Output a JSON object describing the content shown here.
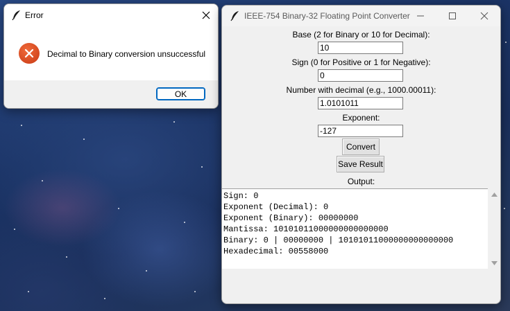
{
  "error_dialog": {
    "title": "Error",
    "message": "Decimal to Binary conversion unsuccessful",
    "ok_label": "OK",
    "icon": "error-icon",
    "icon_color": "#d9481c"
  },
  "main_window": {
    "title": "IEEE-754 Binary-32 Floating Point Converter",
    "fields": [
      {
        "label": "Base (2 for Binary or 10 for Decimal):",
        "value": "10"
      },
      {
        "label": "Sign (0 for Positive or 1 for Negative):",
        "value": "0"
      },
      {
        "label": "Number with decimal (e.g., 1000.00011):",
        "value": "1.0101011"
      },
      {
        "label": "Exponent:",
        "value": "-127"
      }
    ],
    "convert_label": "Convert",
    "save_label": "Save Result",
    "output_label": "Output:",
    "output_lines": [
      "Sign: 0",
      "Exponent (Decimal): 0",
      "Exponent (Binary): 00000000",
      "Mantissa: 10101011000000000000000",
      "Binary: 0 | 00000000 | 10101011000000000000000",
      "Hexadecimal: 00558000"
    ]
  }
}
